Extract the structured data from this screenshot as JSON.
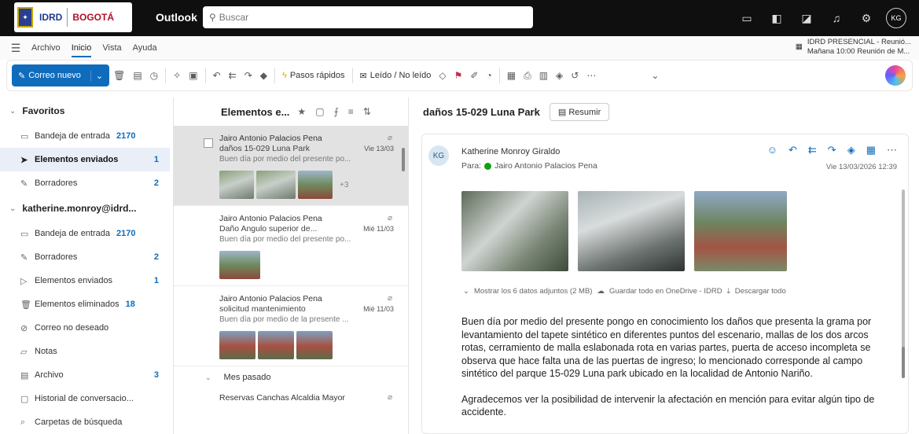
{
  "topbar": {
    "logo_idrd": "IDRD",
    "logo_bogota": "BOGOTÁ",
    "app_name": "Outlook",
    "search_placeholder": "Buscar",
    "avatar_initials": "KG"
  },
  "menubar": {
    "tabs": [
      "Archivo",
      "Inicio",
      "Vista",
      "Ayuda"
    ],
    "reminder_title": "IDRD PRESENCIAL - Reunió...",
    "reminder_sub": "Mañana 10:00 Reunión de M..."
  },
  "ribbon": {
    "new_mail": "Correo nuevo",
    "quick_steps": "Pasos rápidos",
    "read_unread": "Leído / No leído"
  },
  "nav": {
    "favorites_label": "Favoritos",
    "favorites": [
      {
        "label": "Bandeja de entrada",
        "count": "2170"
      },
      {
        "label": "Elementos enviados",
        "count": "1"
      },
      {
        "label": "Borradores",
        "count": "2"
      }
    ],
    "account_label": "katherine.monroy@idrd...",
    "account_items": [
      {
        "label": "Bandeja de entrada",
        "count": "2170"
      },
      {
        "label": "Borradores",
        "count": "2"
      },
      {
        "label": "Elementos enviados",
        "count": "1"
      },
      {
        "label": "Elementos eliminados",
        "count": "18"
      },
      {
        "label": "Correo no deseado",
        "count": ""
      },
      {
        "label": "Notas",
        "count": ""
      },
      {
        "label": "Archivo",
        "count": "3"
      },
      {
        "label": "Historial de conversacio...",
        "count": ""
      },
      {
        "label": "Carpetas de búsqueda",
        "count": ""
      }
    ]
  },
  "list": {
    "title": "Elementos e...",
    "messages": [
      {
        "from": "Jairo Antonio Palacios Pena",
        "subject": "daños 15-029 Luna Park",
        "date": "Vie 13/03",
        "preview": "Buen día por medio del presente po...",
        "more": "+3"
      },
      {
        "from": "Jairo Antonio Palacios Pena",
        "subject": "Daño Angulo superior de...",
        "date": "Mié 11/03",
        "preview": "Buen día por medio del presente po..."
      },
      {
        "from": "Jairo Antonio Palacios Pena",
        "subject": "solicitud mantenimiento",
        "date": "Mié 11/03",
        "preview": "Buen día por medio de la presente ..."
      }
    ],
    "section_label": "Mes pasado",
    "last_from": "Reservas Canchas Alcaldia Mayor"
  },
  "reading": {
    "subject": "daños 15-029 Luna Park",
    "summarize": "Resumir",
    "sender_initials": "KG",
    "sender": "Katherine Monroy Giraldo",
    "to_prefix": "Para:",
    "to": "Jairo Antonio Palacios Pena",
    "date": "Vie 13/03/2026 12:39",
    "attach_show": "Mostrar los 6 datos adjuntos (2 MB)",
    "attach_save": "Guardar todo en OneDrive - IDRD",
    "attach_download": "Descargar todo",
    "body_p1": "Buen día por medio del presente pongo en conocimiento los daños que presenta la grama por levantamiento del tapete sintético en diferentes puntos del escenario, mallas de los dos arcos rotas, cerramiento de malla eslabonada rota en varias partes, puerta de acceso incompleta se observa que hace falta una de las puertas de ingreso; lo mencionado corresponde al campo sintético  del parque  15-029 Luna park ubicado en la localidad de Antonio Nariño.",
    "body_p2": "Agradecemos ver la posibilidad de intervenir la afectación en mención para evitar algún tipo de accidente."
  }
}
